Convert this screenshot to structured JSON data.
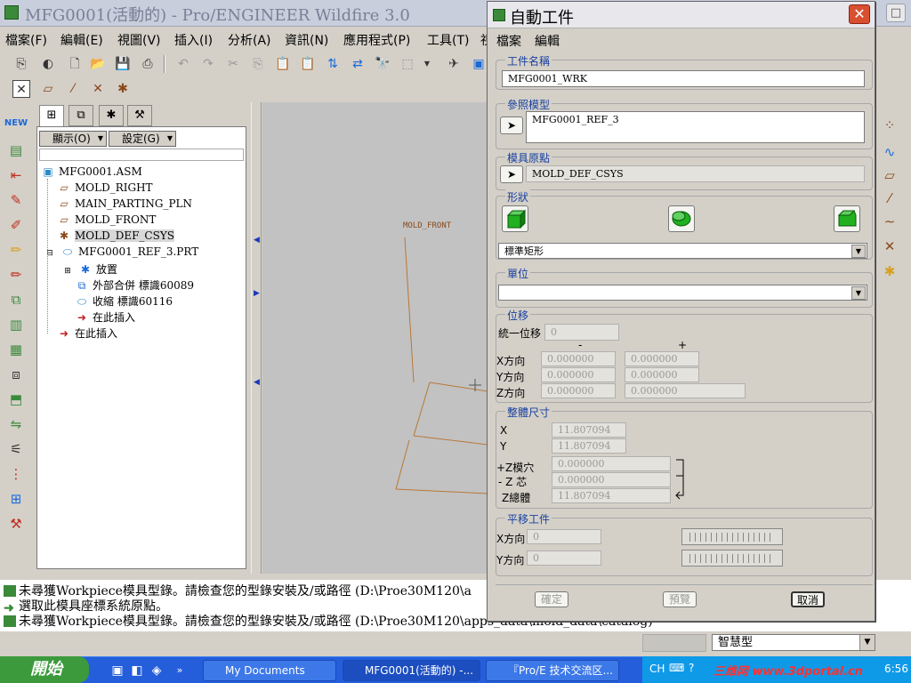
{
  "main_window": {
    "title": "MFG0001(活動的) - Pro/ENGINEER Wildfire 3.0",
    "menu": [
      "檔案(F)",
      "編輯(E)",
      "視圖(V)",
      "插入(I)",
      "分析(A)",
      "資訊(N)",
      "應用程式(P)",
      "工具(T)",
      "視"
    ]
  },
  "model_tree": {
    "display_menu": "顯示(O)",
    "settings_menu": "設定(G)",
    "items": [
      {
        "label": "MFG0001.ASM",
        "icon": "assembly-icon"
      },
      {
        "label": "MOLD_RIGHT",
        "icon": "datum-plane-icon"
      },
      {
        "label": "MAIN_PARTING_PLN",
        "icon": "datum-plane-icon"
      },
      {
        "label": "MOLD_FRONT",
        "icon": "datum-plane-icon"
      },
      {
        "label": "MOLD_DEF_CSYS",
        "icon": "csys-icon"
      },
      {
        "label": "MFG0001_REF_3.PRT",
        "icon": "part-icon"
      },
      {
        "label": "放置",
        "icon": "placement-icon"
      },
      {
        "label": "外部合併 標識60089",
        "icon": "merge-icon"
      },
      {
        "label": "收縮 標識60116",
        "icon": "shrink-icon"
      },
      {
        "label": "在此插入",
        "icon": "insert-here-icon"
      },
      {
        "label": "在此插入",
        "icon": "insert-here-icon"
      }
    ]
  },
  "viewport": {
    "datum_label": "MOLD_FRONT"
  },
  "dialog": {
    "title": "自動工件",
    "menu": [
      "檔案",
      "編輯"
    ],
    "workpiece_name": {
      "label": "工件名稱",
      "value": "MFG0001_WRK"
    },
    "ref_model": {
      "label": "參照模型",
      "value": "MFG0001_REF_3"
    },
    "mold_origin": {
      "label": "模具原點",
      "value": "MOLD_DEF_CSYS"
    },
    "shape": {
      "label": "形狀",
      "value": "標準矩形"
    },
    "unit": {
      "label": "單位",
      "value": ""
    },
    "offset": {
      "label": "位移",
      "uniform_label": "統一位移",
      "uniform_value": "0",
      "minus": "-",
      "plus": "+",
      "rows": [
        {
          "label": "X方向",
          "minus": "0.000000",
          "plus": "0.000000"
        },
        {
          "label": "Y方向",
          "minus": "0.000000",
          "plus": "0.000000"
        },
        {
          "label": "Z方向",
          "minus": "0.000000",
          "plus": "0.000000"
        }
      ]
    },
    "overall": {
      "label": "整體尺寸",
      "x_label": "X",
      "x_value": "11.807094",
      "y_label": "Y",
      "y_value": "11.807094",
      "zcav_label": "+Z模穴",
      "zcav_value": "0.000000",
      "zcore_label": "- Z 芯",
      "zcore_value": "0.000000",
      "ztotal_label": "Z總體",
      "ztotal_value": "11.807094"
    },
    "translate": {
      "label": "平移工件",
      "x_label": "X方向",
      "x_value": "0",
      "y_label": "Y方向",
      "y_value": "0"
    },
    "buttons": {
      "ok": "確定",
      "preview": "預覽",
      "cancel": "取消"
    }
  },
  "messages": [
    "未尋獲Workpiece模具型錄。請檢查您的型錄安裝及/或路徑 (D:\\Proe30M120\\a",
    "選取此模具座標系統原點。",
    "未尋獲Workpiece模具型錄。請檢查您的型錄安裝及/或路徑 (D:\\Proe30M120\\apps_data\\mold_data\\catalog)"
  ],
  "smart_filter": "智慧型",
  "taskbar": {
    "start": "開始",
    "tasks": [
      "My Documents",
      "MFG0001(活動的) -...",
      "『Pro/E 技术交流区..."
    ],
    "tray_lang": "CH",
    "tray_time": "6:56",
    "watermark": "三维网 www.3dportal.cn"
  },
  "colors": {
    "dialog_group_label": "#1840a0",
    "close_button": "#d85030",
    "taskbar": "#245edb",
    "datum_lines": "#b87838"
  }
}
